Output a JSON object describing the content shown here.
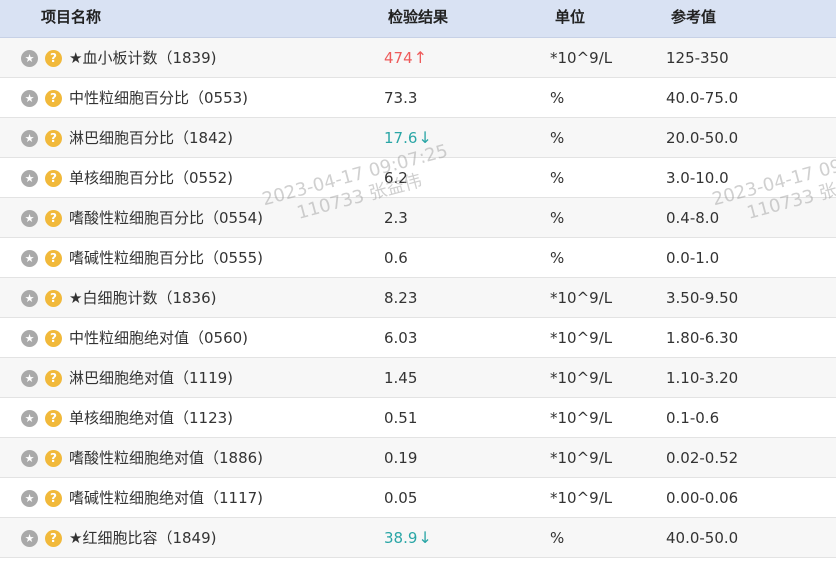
{
  "columns": {
    "name": "项目名称",
    "result": "检验结果",
    "unit": "单位",
    "reference": "参考值"
  },
  "rows": [
    {
      "name": "★血小板计数（1839)",
      "result": "474",
      "flag": "↑",
      "status": "up",
      "unit": "*10^9/L",
      "reference": "125-350"
    },
    {
      "name": "中性粒细胞百分比（0553)",
      "result": "73.3",
      "flag": "",
      "status": "normal",
      "unit": "%",
      "reference": "40.0-75.0"
    },
    {
      "name": "淋巴细胞百分比（1842)",
      "result": "17.6",
      "flag": "↓",
      "status": "down",
      "unit": "%",
      "reference": "20.0-50.0"
    },
    {
      "name": "单核细胞百分比（0552)",
      "result": "6.2",
      "flag": "",
      "status": "normal",
      "unit": "%",
      "reference": "3.0-10.0"
    },
    {
      "name": "嗜酸性粒细胞百分比（0554)",
      "result": "2.3",
      "flag": "",
      "status": "normal",
      "unit": "%",
      "reference": "0.4-8.0"
    },
    {
      "name": "嗜碱性粒细胞百分比（0555)",
      "result": "0.6",
      "flag": "",
      "status": "normal",
      "unit": "%",
      "reference": "0.0-1.0"
    },
    {
      "name": "★白细胞计数（1836)",
      "result": "8.23",
      "flag": "",
      "status": "normal",
      "unit": "*10^9/L",
      "reference": "3.50-9.50"
    },
    {
      "name": "中性粒细胞绝对值（0560)",
      "result": "6.03",
      "flag": "",
      "status": "normal",
      "unit": "*10^9/L",
      "reference": "1.80-6.30"
    },
    {
      "name": "淋巴细胞绝对值（1119)",
      "result": "1.45",
      "flag": "",
      "status": "normal",
      "unit": "*10^9/L",
      "reference": "1.10-3.20"
    },
    {
      "name": "单核细胞绝对值（1123)",
      "result": "0.51",
      "flag": "",
      "status": "normal",
      "unit": "*10^9/L",
      "reference": "0.1-0.6"
    },
    {
      "name": "嗜酸性粒细胞绝对值（1886)",
      "result": "0.19",
      "flag": "",
      "status": "normal",
      "unit": "*10^9/L",
      "reference": "0.02-0.52"
    },
    {
      "name": "嗜碱性粒细胞绝对值（1117)",
      "result": "0.05",
      "flag": "",
      "status": "normal",
      "unit": "*10^9/L",
      "reference": "0.00-0.06"
    },
    {
      "name": "★红细胞比容（1849)",
      "result": "38.9",
      "flag": "↓",
      "status": "down",
      "unit": "%",
      "reference": "40.0-50.0"
    }
  ],
  "row_icons": {
    "star": "star-icon",
    "help": "question-icon"
  },
  "watermark": {
    "line1": "2023-04-17 09:07:25",
    "line2": "110733 张益伟",
    "line1_right": "2023-04-17 09",
    "line2_right": "110733 张"
  },
  "colors": {
    "header_bg": "#d9e2f3",
    "up": "#ee5b5b",
    "down": "#2aa6a6",
    "help_icon": "#f1b93b",
    "star_icon": "#a9a9a9"
  }
}
